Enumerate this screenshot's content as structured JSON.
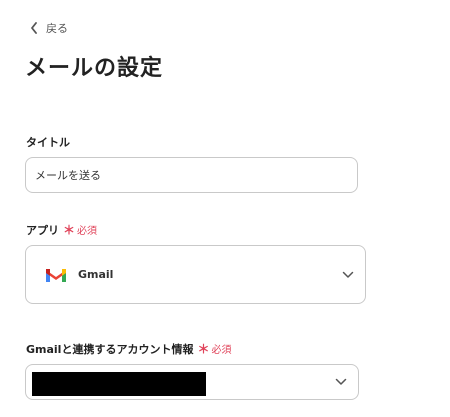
{
  "back": {
    "label": "戻る",
    "icon": "chevron-left-icon"
  },
  "page": {
    "title": "メールの設定"
  },
  "title_field": {
    "label": "タイトル",
    "value": "メールを送る"
  },
  "app_field": {
    "label": "アプリ",
    "required_mark": "＊",
    "required_text": "必須",
    "selected_app": "Gmail",
    "icon": "gmail-icon"
  },
  "account_field": {
    "label": "Gmailと連携するアカウント情報",
    "required_mark": "＊",
    "required_text": "必須"
  },
  "colors": {
    "required": "#e0435a",
    "border": "#c9c9c9",
    "text": "#333333"
  }
}
